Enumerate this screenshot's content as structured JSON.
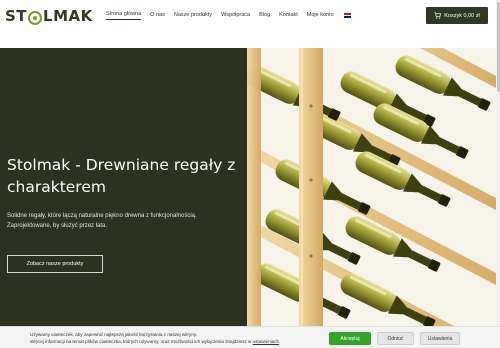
{
  "header": {
    "logo_text_left": "ST",
    "logo_text_right": "LMAK",
    "nav": [
      {
        "label": "Strona główna",
        "active": true
      },
      {
        "label": "O nas",
        "active": false
      },
      {
        "label": "Nasze produkty",
        "active": false
      },
      {
        "label": "Współpraca",
        "active": false
      },
      {
        "label": "Blog",
        "active": false
      },
      {
        "label": "Kontakt",
        "active": false
      },
      {
        "label": "Moje konto",
        "active": false
      }
    ],
    "language_flag": "uk-flag-icon",
    "cart": {
      "label": "Koszyk 0,00 zł",
      "icon": "cart-icon"
    }
  },
  "hero": {
    "title": "Stolmak - Drewniane regały z charakterem",
    "description": "Solidne regały, które łączą naturalne piękno drewna z funkcjonalnością. Zaprojektowane, by służyć przez lata.",
    "button_label": "Zobacz nasze produkty"
  },
  "cookie": {
    "text_line1": "Używamy ciasteczek, aby zapewnić najlepszą jakość korzystania z naszej witryny.",
    "text_line2_prefix": "Więcej informacji na temat plików ciasteczka, których używamy, oraz możliwości ich wyłączenia znajdziesz w ",
    "link_label": "ustawieniach",
    "text_line2_suffix": ".",
    "accept_label": "Akceptuj",
    "reject_label": "Odrzuć",
    "settings_label": "Ustawienia"
  },
  "colors": {
    "brand_dark": "#2b3220",
    "logo_green": "#7a9a2a",
    "accept_green": "#34a32b"
  }
}
